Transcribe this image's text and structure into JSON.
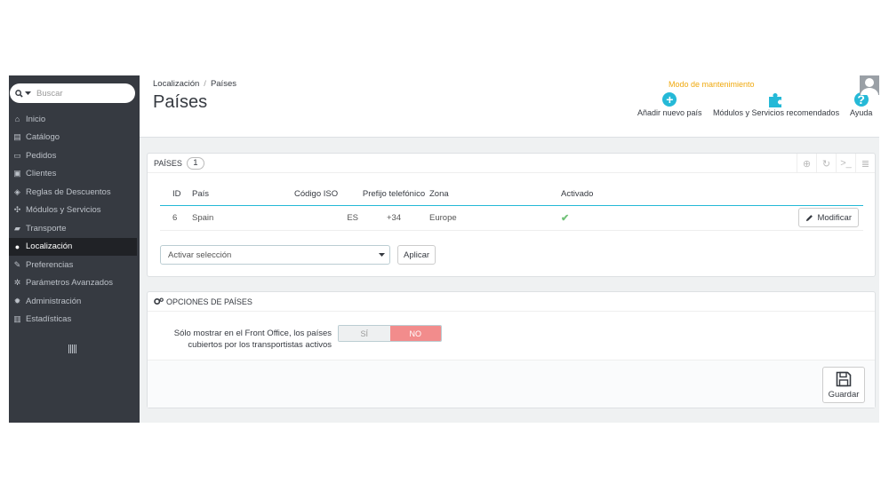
{
  "search": {
    "placeholder": "Buscar"
  },
  "sidebar": {
    "items": [
      {
        "label": "Inicio",
        "icon": "home-icon"
      },
      {
        "label": "Catálogo",
        "icon": "book-icon"
      },
      {
        "label": "Pedidos",
        "icon": "credit-card-icon"
      },
      {
        "label": "Clientes",
        "icon": "users-icon"
      },
      {
        "label": "Reglas de Descuentos",
        "icon": "tags-icon"
      },
      {
        "label": "Módulos y Servicios",
        "icon": "puzzle-icon"
      },
      {
        "label": "Transporte",
        "icon": "truck-icon"
      },
      {
        "label": "Localización",
        "icon": "globe-icon",
        "active": true
      },
      {
        "label": "Preferencias",
        "icon": "wrench-icon"
      },
      {
        "label": "Parámetros Avanzados",
        "icon": "cogs-icon"
      },
      {
        "label": "Administración",
        "icon": "gear-icon"
      },
      {
        "label": "Estadísticas",
        "icon": "bar-chart-icon"
      }
    ]
  },
  "header": {
    "breadcrumb": [
      "Localización",
      "Países"
    ],
    "breadcrumb_sep": "/",
    "title": "Países",
    "maintenance": "Modo de mantenimiento",
    "toolbar": {
      "add_label": "Añadir nuevo país",
      "modules_label": "Módulos y Servicios recomendados",
      "help_label": "Ayuda"
    }
  },
  "countries_panel": {
    "heading": "Países",
    "count": "1",
    "columns": [
      "ID",
      "País",
      "Código ISO",
      "Prefijo telefónico",
      "Zona",
      "Activado"
    ],
    "rows": [
      {
        "id": "6",
        "pais": "Spain",
        "iso": "ES",
        "prefijo": "+34",
        "zona": "Europe",
        "activado": true,
        "action": "Modificar"
      }
    ],
    "bulk_select": "Activar selección",
    "apply_label": "Aplicar"
  },
  "options_panel": {
    "heading": "Opciones de países",
    "option_label": "Sólo mostrar en el Front Office, los países cubiertos por los transportistas activos",
    "switch_yes": "SÍ",
    "switch_no": "NO",
    "switch_value": "NO",
    "save_label": "Guardar"
  },
  "colors": {
    "sidebar_bg": "#363a41",
    "accent": "#25b9d7",
    "maintenance": "#f0a90e",
    "switch_no": "#f28c8c",
    "check": "#72c279"
  }
}
